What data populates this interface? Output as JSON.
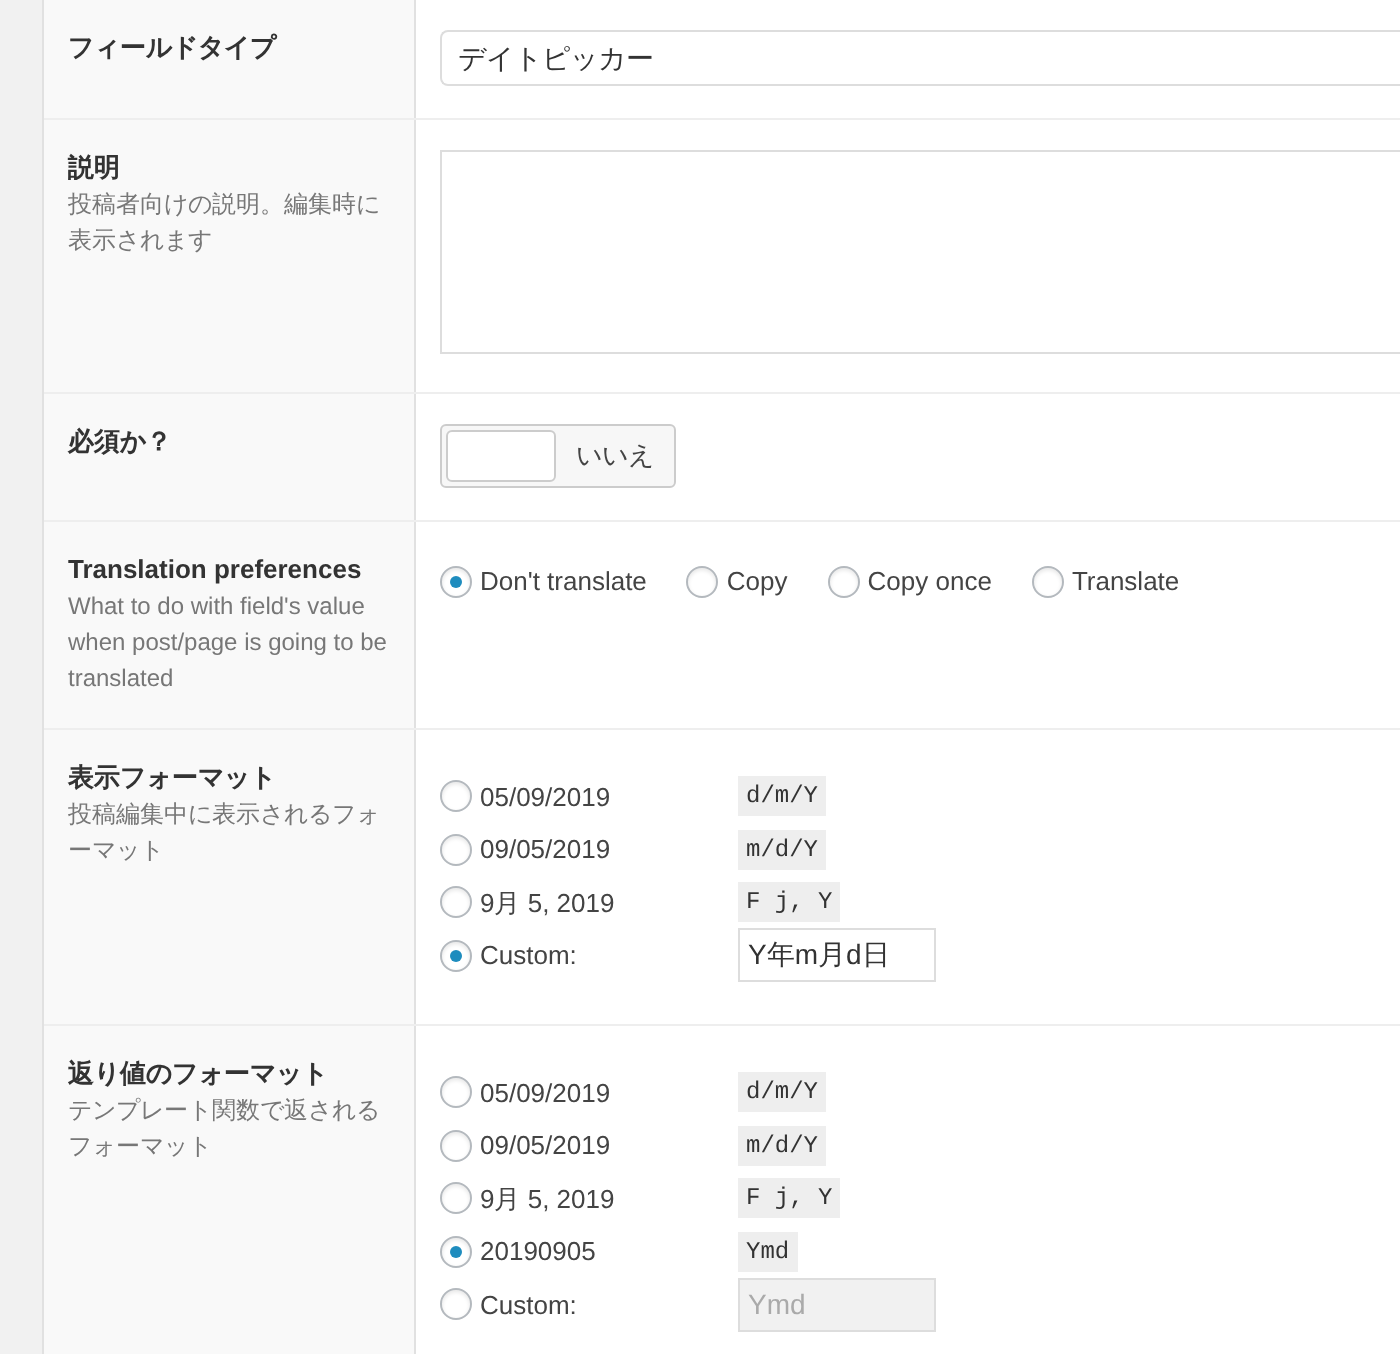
{
  "rows": [
    {
      "kind": "select",
      "label": "フィールドタイプ",
      "value": "デイトピッカー"
    },
    {
      "kind": "textarea",
      "label": "説明",
      "description": "投稿者向けの説明。編集時に表示されます"
    },
    {
      "kind": "toggle",
      "label": "必須か？",
      "on": false,
      "toggle_label": "いいえ"
    },
    {
      "kind": "radio_inline",
      "label": "Translation preferences",
      "description": "What to do with field's value when post/page is going to be translated",
      "options": [
        {
          "label": "Don't translate",
          "selected": true
        },
        {
          "label": "Copy",
          "selected": false
        },
        {
          "label": "Copy once",
          "selected": false
        },
        {
          "label": "Translate",
          "selected": false
        }
      ]
    },
    {
      "kind": "radio_format",
      "label": "表示フォーマット",
      "description": "投稿編集中に表示されるフォーマット",
      "options": [
        {
          "label": "05/09/2019",
          "format": "d/m/Y",
          "selected": false
        },
        {
          "label": "09/05/2019",
          "format": "m/d/Y",
          "selected": false
        },
        {
          "label": "9月 5, 2019",
          "format": "F j, Y",
          "selected": false
        },
        {
          "label": "Custom:",
          "custom_value": "Y年m月d日",
          "selected": true
        }
      ]
    },
    {
      "kind": "radio_format",
      "label": "返り値のフォーマット",
      "description": "テンプレート関数で返されるフォーマット",
      "options": [
        {
          "label": "05/09/2019",
          "format": "d/m/Y",
          "selected": false
        },
        {
          "label": "09/05/2019",
          "format": "m/d/Y",
          "selected": false
        },
        {
          "label": "9月 5, 2019",
          "format": "F j, Y",
          "selected": false
        },
        {
          "label": "20190905",
          "format": "Ymd",
          "selected": true
        },
        {
          "label": "Custom:",
          "placeholder": "Ymd",
          "selected": false
        }
      ]
    }
  ]
}
